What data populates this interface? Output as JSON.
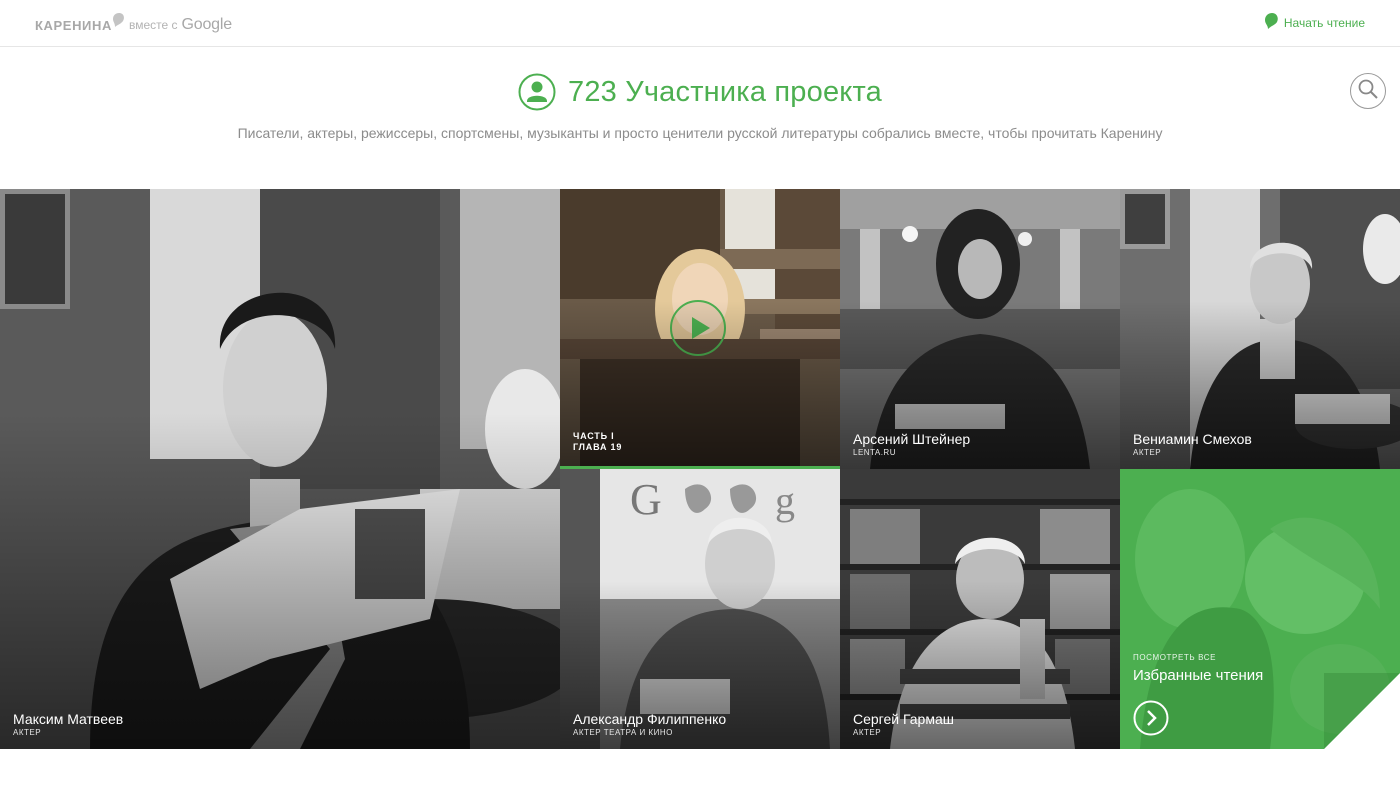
{
  "header": {
    "logo_text": "КАРЕНИНА",
    "logo_with": "вместе с",
    "logo_google": "Google",
    "start_reading": "Начать чтение"
  },
  "hero": {
    "title": "723 Участника проекта",
    "subtitle": "Писатели, актеры, режиссеры, спортсмены, музыканты и просто ценители русской литературы собрались вместе, чтобы прочитать Каренину"
  },
  "tiles": [
    {
      "name": "Максим Матвеев",
      "role": "АКТЕР"
    },
    {
      "chapter_part": "ЧАСТЬ I",
      "chapter_num": "ГЛАВА 19",
      "progress": 1.0
    },
    {
      "name": "Арсений Штейнер",
      "role": "LENTA.RU"
    },
    {
      "name": "Вениамин Смехов",
      "role": "АКТЕР"
    },
    {
      "name": "Александр Филиппенко",
      "role": "АКТЕР ТЕАТРА И КИНО"
    },
    {
      "name": "Сергей Гармаш",
      "role": "АКТЕР"
    }
  ],
  "favorites": {
    "small": "ПОСМОТРЕТЬ ВСЕ",
    "title": "Избранные чтения"
  },
  "colors": {
    "accent": "#4caf50",
    "text_muted": "#8c8c8c"
  },
  "icons": [
    "leaf-icon",
    "user-icon",
    "search-icon",
    "play-icon",
    "chevron-right-icon"
  ]
}
